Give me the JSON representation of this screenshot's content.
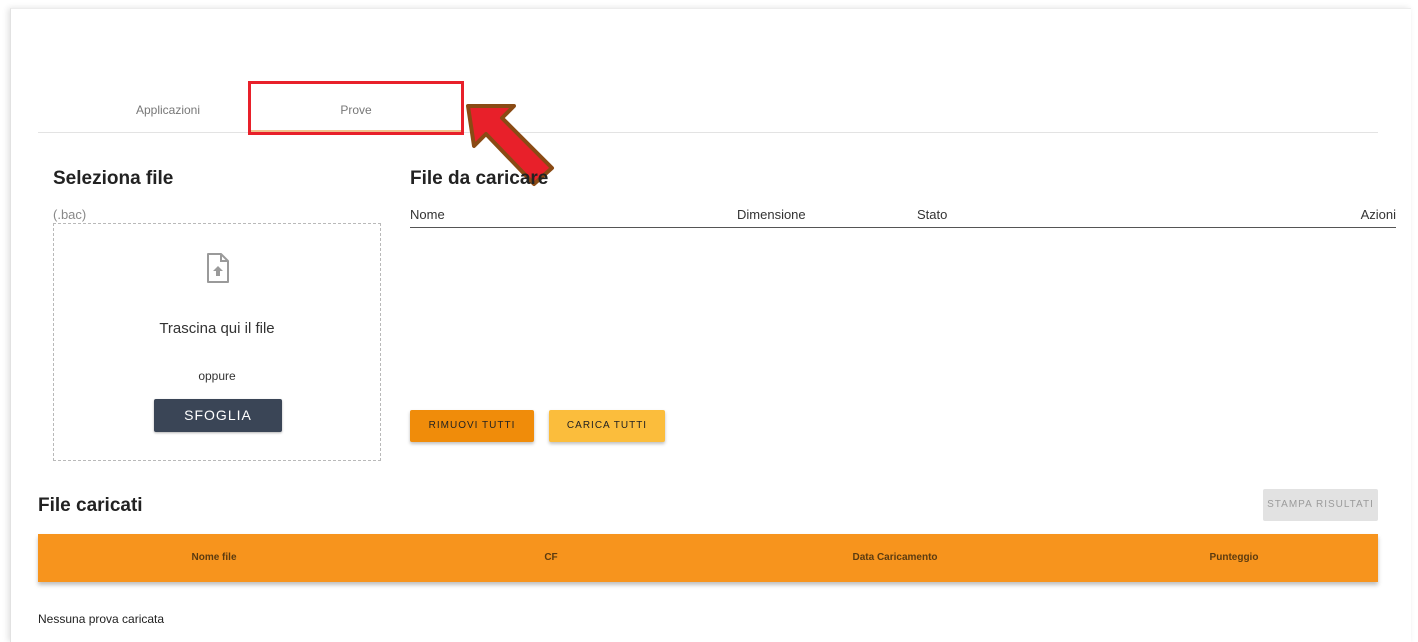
{
  "tabs": [
    {
      "label": "Applicazioni",
      "active": false
    },
    {
      "label": "Prove",
      "active": true
    }
  ],
  "select_file": {
    "title": "Seleziona file",
    "extension_hint": "(.bac)",
    "drop_text": "Trascina qui il file",
    "or_text": "oppure",
    "browse_label": "SFOGLIA",
    "icon": "file-upload-icon"
  },
  "upload_queue": {
    "title": "File da caricare",
    "columns": [
      "Nome",
      "Dimensione",
      "Stato",
      "Azioni"
    ],
    "rows": [],
    "remove_all_label": "RIMUOVI TUTTI",
    "upload_all_label": "CARICA TUTTI"
  },
  "uploaded": {
    "title": "File caricati",
    "print_label": "STAMPA RISULTATI",
    "columns": [
      "Nome file",
      "CF",
      "Data Caricamento",
      "Punteggio"
    ],
    "empty_message": "Nessuna prova caricata"
  },
  "colors": {
    "accent_orange": "#f7941d",
    "remove_button": "#f08c0a",
    "upload_button": "#fbbd3c",
    "browse_button": "#3a4556",
    "highlight_red": "#e8202a"
  }
}
